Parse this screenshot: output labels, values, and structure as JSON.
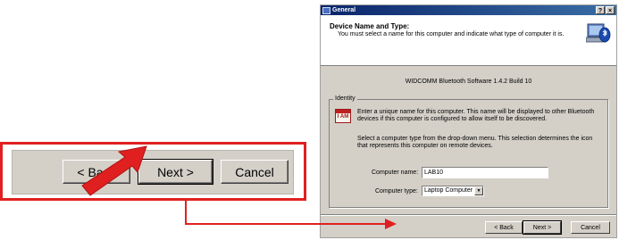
{
  "zoom": {
    "back_label": "< Back",
    "next_label": "Next >",
    "cancel_label": "Cancel"
  },
  "dialog": {
    "title": "General",
    "help_button": "?",
    "close_button": "×",
    "header_title": "Device Name and Type:",
    "header_subtitle": "You must select a name for this computer and indicate what type of computer it is.",
    "build_line": "WIDCOMM Bluetooth Software 1.4.2 Build 10",
    "identity_legend": "Identity",
    "identity_icon_text": "I AM",
    "para1": "Enter a unique name for this computer.  This name will be displayed to other Bluetooth devices if this computer is configured to allow itself to be discovered.",
    "para2": "Select a computer type from the drop-down menu.  This selection determines the icon that represents this computer on remote devices.",
    "computer_name_label": "Computer name:",
    "computer_name_value": "LAB10",
    "computer_type_label": "Computer type:",
    "computer_type_value": "Laptop Computer",
    "back_label": "< Back",
    "next_label": "Next >",
    "cancel_label": "Cancel"
  },
  "colors": {
    "highlight_red": "#e02020",
    "dialog_face": "#d4d0c8",
    "titlebar_start": "#0a246a",
    "titlebar_end": "#3a6ea5"
  }
}
